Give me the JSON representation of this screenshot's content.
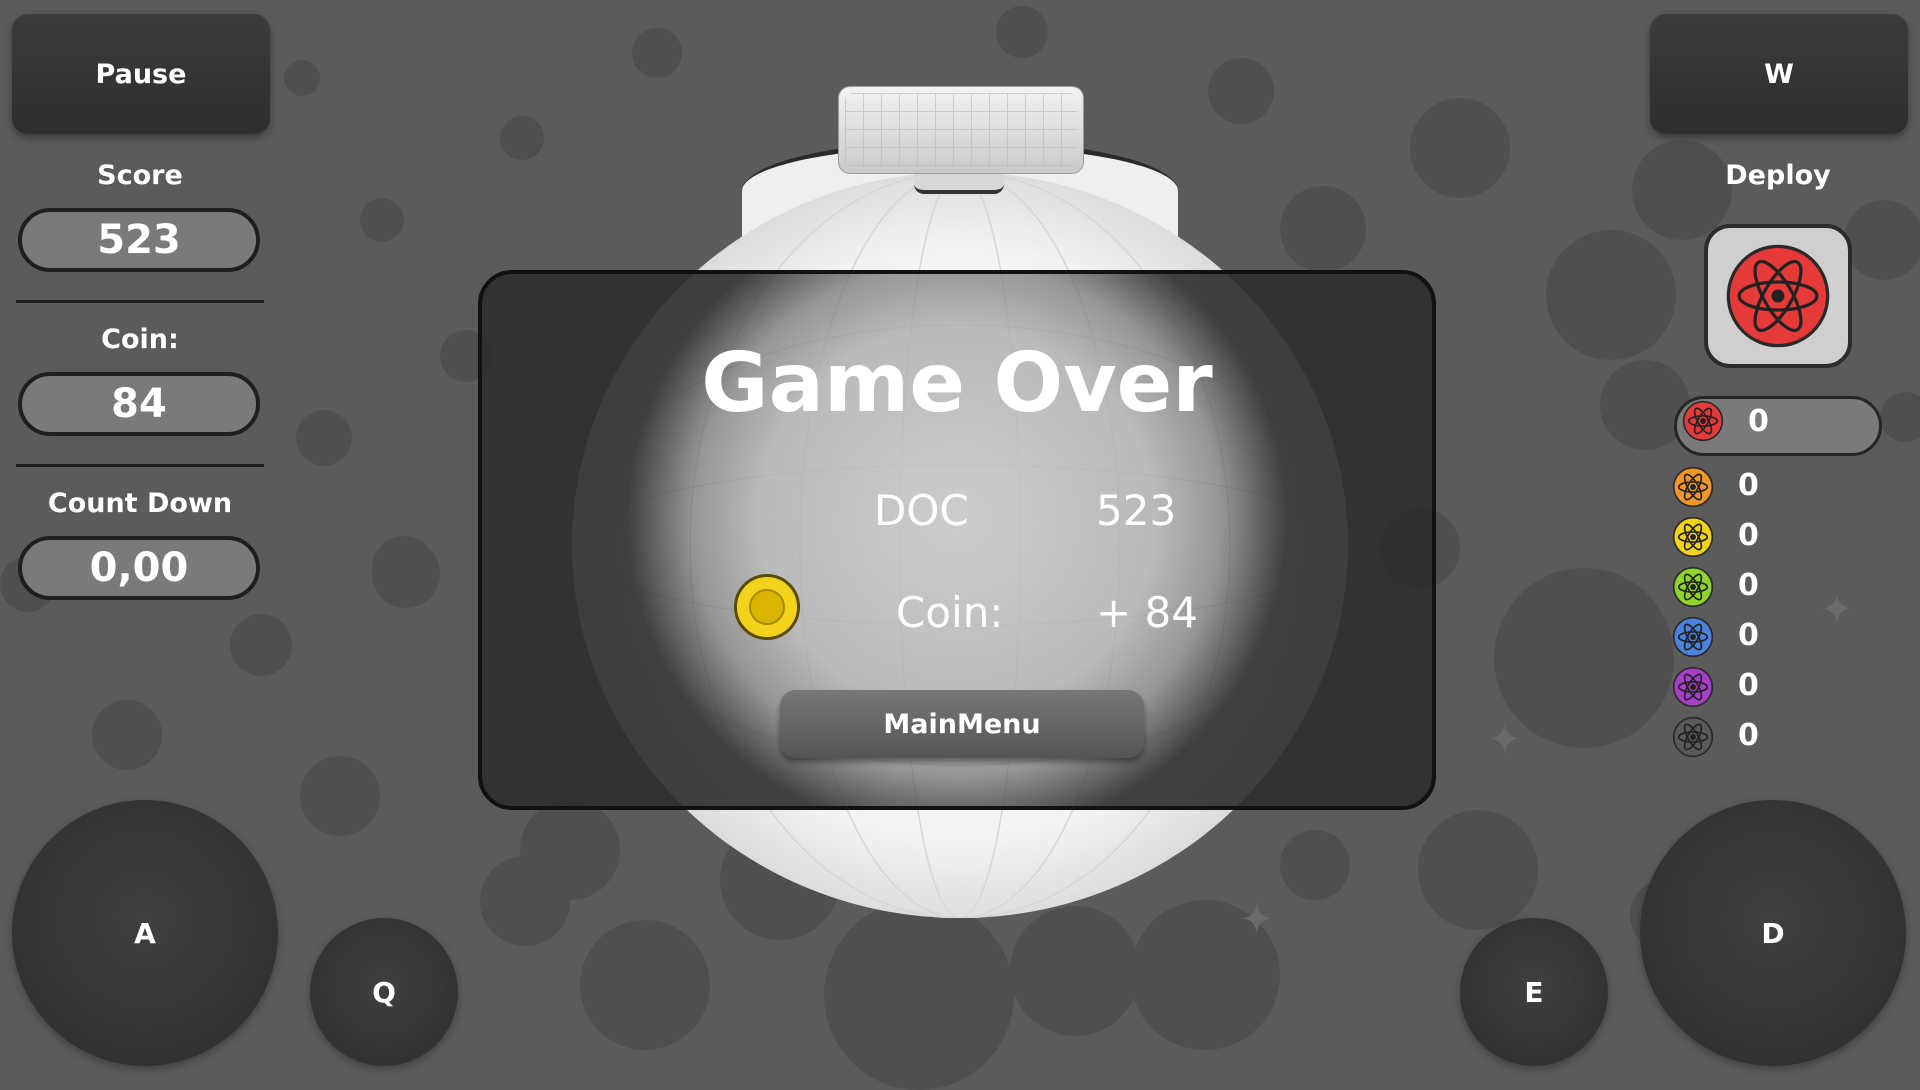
{
  "hud": {
    "pause_label": "Pause",
    "w_label": "W",
    "score_label": "Score",
    "score_value": "523",
    "coin_label": "Coin:",
    "coin_value": "84",
    "countdown_label": "Count Down",
    "countdown_value": "0,00",
    "deploy_label": "Deploy"
  },
  "dialog": {
    "title": "Game Over",
    "rows": [
      {
        "label": "DOC",
        "value": "523"
      },
      {
        "label": "Coin:",
        "value": "+ 84"
      }
    ],
    "mainmenu_label": "MainMenu"
  },
  "ammo": [
    {
      "color": "#e63a3a",
      "count": "0"
    },
    {
      "color": "#f2962a",
      "count": "0"
    },
    {
      "color": "#f2d21a",
      "count": "0"
    },
    {
      "color": "#8fd42a",
      "count": "0"
    },
    {
      "color": "#4a82e0",
      "count": "0"
    },
    {
      "color": "#a83ec8",
      "count": "0"
    },
    {
      "color": "#5a5a5a",
      "count": "0"
    }
  ],
  "controls": {
    "a_label": "A",
    "q_label": "Q",
    "e_label": "E",
    "d_label": "D"
  },
  "icons": {
    "deploy": "atom-icon",
    "coin": "coin-icon"
  }
}
